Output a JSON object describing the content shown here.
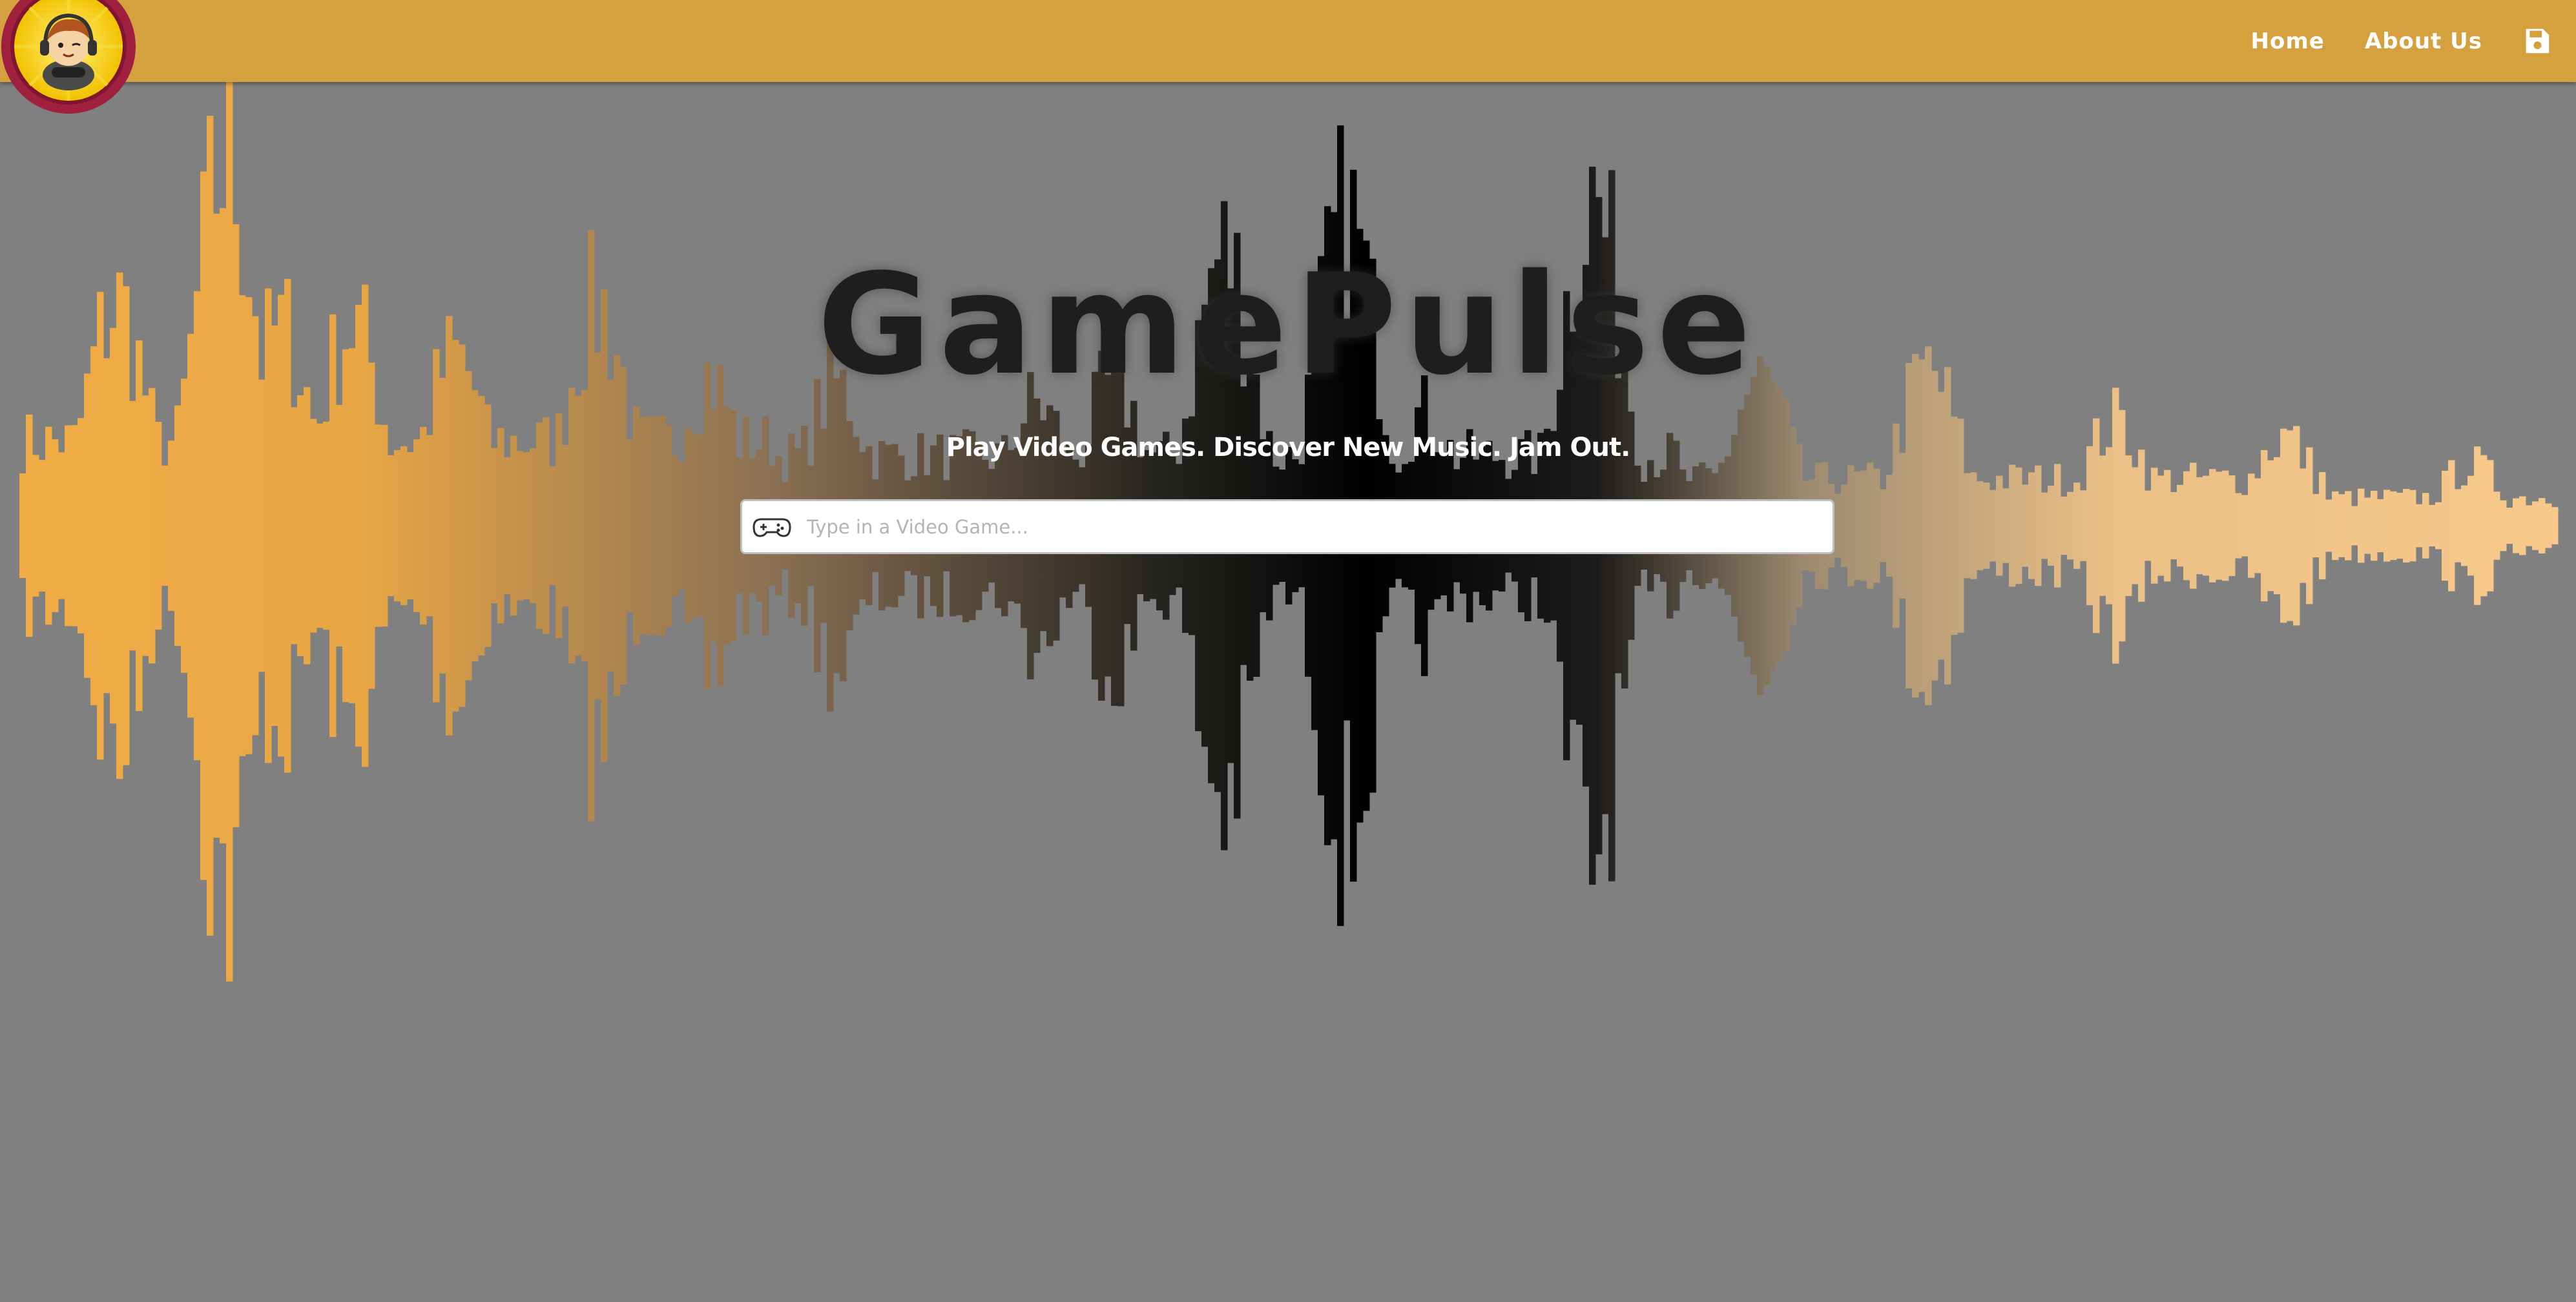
{
  "nav": {
    "home_label": "Home",
    "about_label": "About Us",
    "save_icon": "floppy-disk-icon"
  },
  "logo": {
    "icon": "gamer-avatar-logo"
  },
  "hero": {
    "title": "GamePulse",
    "tagline": "Play Video Games. Discover New Music. Jam Out."
  },
  "search": {
    "icon": "gamepad-icon",
    "placeholder": "Type in a Video Game...",
    "value": ""
  },
  "colors": {
    "header": "#D5A03E",
    "background": "#808080",
    "wave_left": "#F2AC45",
    "wave_center": "#000000",
    "wave_right": "#F8C98A",
    "logo_ring": "#A0203F"
  }
}
